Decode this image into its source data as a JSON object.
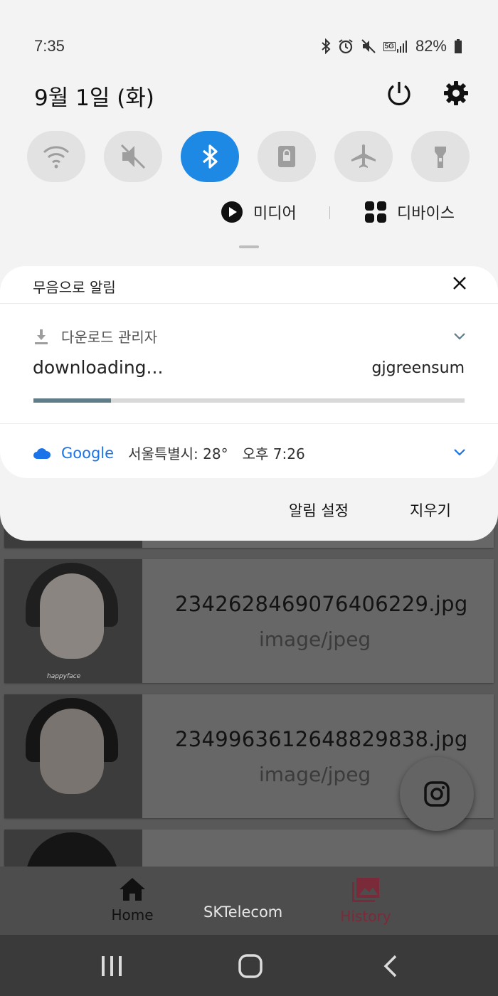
{
  "status_bar": {
    "time": "7:35",
    "battery": "82%",
    "network_badge": "5G",
    "icons": [
      "bluetooth-icon",
      "alarm-icon",
      "mute-icon",
      "signal-icon",
      "battery-icon"
    ]
  },
  "header": {
    "date": "9월 1일 (화)",
    "icons": [
      "power-icon",
      "settings-icon"
    ]
  },
  "quick_settings": [
    {
      "name": "wifi",
      "icon": "wifi-icon",
      "active": false
    },
    {
      "name": "sound",
      "icon": "mute-icon",
      "active": false
    },
    {
      "name": "bluetooth",
      "icon": "bluetooth-icon",
      "active": true
    },
    {
      "name": "rotation-lock",
      "icon": "lock-icon",
      "active": false
    },
    {
      "name": "airplane",
      "icon": "airplane-icon",
      "active": false
    },
    {
      "name": "flashlight",
      "icon": "flashlight-icon",
      "active": false
    }
  ],
  "media_row": {
    "media_label": "미디어",
    "devices_label": "디바이스"
  },
  "notification_panel": {
    "silent_header": "무음으로 알림",
    "download": {
      "app_name": "다운로드 관리자",
      "title": "downloading...",
      "user": "gjgreensum",
      "progress": 0.18
    },
    "google": {
      "app_name": "Google",
      "detail": "서울특별시: 28°",
      "time": "오후 7:26"
    }
  },
  "shade_actions": {
    "settings": "알림 설정",
    "clear": "지우기"
  },
  "background_list": [
    {
      "filename": "2342628469076406229.jpg",
      "type": "image/jpeg",
      "watermark": "happyface"
    },
    {
      "filename": "2349963612648829838.jpg",
      "type": "image/jpeg"
    }
  ],
  "bottom_nav": {
    "home": "Home",
    "carrier": "SKTelecom",
    "history": "History"
  },
  "colors": {
    "accent_blue": "#1e88e5",
    "google_blue": "#1a73e8",
    "history_active": "#7b2a3a"
  }
}
